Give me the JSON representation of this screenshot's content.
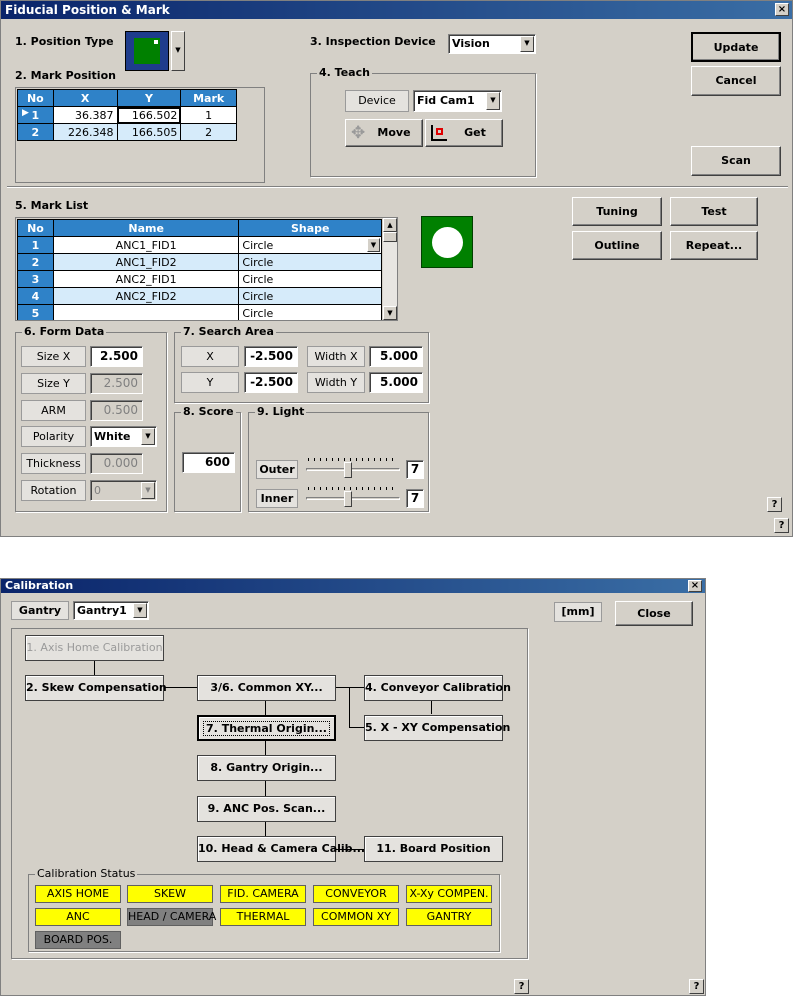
{
  "fiducial": {
    "title": "Fiducial Position & Mark",
    "close_glyph": "×",
    "position_type_label": "1. Position Type",
    "mark_position_label": "2. Mark Position",
    "mark_position_table": {
      "headers": [
        "No",
        "X",
        "Y",
        "Mark"
      ],
      "rows": [
        {
          "no": "1",
          "x": "36.387",
          "y": "166.502",
          "mark": "1"
        },
        {
          "no": "2",
          "x": "226.348",
          "y": "166.505",
          "mark": "2"
        }
      ]
    },
    "inspection_device_label": "3. Inspection Device",
    "inspection_device_value": "Vision",
    "teach": {
      "group_label": "4. Teach",
      "device_label": "Device",
      "device_value": "Fid Cam1",
      "move_label": "Move",
      "get_label": "Get"
    },
    "update_label": "Update",
    "cancel_label": "Cancel",
    "scan_label": "Scan",
    "mark_list_label": "5. Mark List",
    "mark_list_table": {
      "headers": [
        "No",
        "Name",
        "Shape"
      ],
      "rows": [
        {
          "no": "1",
          "name": "ANC1_FID1",
          "shape": "Circle"
        },
        {
          "no": "2",
          "name": "ANC1_FID2",
          "shape": "Circle"
        },
        {
          "no": "3",
          "name": "ANC2_FID1",
          "shape": "Circle"
        },
        {
          "no": "4",
          "name": "ANC2_FID2",
          "shape": "Circle"
        },
        {
          "no": "5",
          "name": "",
          "shape": "Circle"
        }
      ]
    },
    "tuning_label": "Tuning",
    "test_label": "Test",
    "outline_label": "Outline",
    "repeat_label": "Repeat...",
    "form_data": {
      "group_label": "6. Form Data",
      "size_x_label": "Size X",
      "size_x_value": "2.500",
      "size_y_label": "Size Y",
      "size_y_value": "2.500",
      "arm_label": "ARM",
      "arm_value": "0.500",
      "polarity_label": "Polarity",
      "polarity_value": "White",
      "thickness_label": "Thickness",
      "thickness_value": "0.000",
      "rotation_label": "Rotation",
      "rotation_value": "0"
    },
    "search_area": {
      "group_label": "7. Search Area",
      "x_label": "X",
      "x_value": "-2.500",
      "y_label": "Y",
      "y_value": "-2.500",
      "width_x_label": "Width X",
      "width_x_value": "5.000",
      "width_y_label": "Width Y",
      "width_y_value": "5.000"
    },
    "score": {
      "group_label": "8. Score",
      "value": "600"
    },
    "light": {
      "group_label": "9. Light",
      "outer_label": "Outer",
      "outer_value": "7",
      "outer_level_fraction": 0.44,
      "inner_label": "Inner",
      "inner_value": "7",
      "inner_level_fraction": 0.44
    },
    "help_glyph": "?"
  },
  "calibration": {
    "title": "Calibration",
    "close_glyph": "×",
    "gantry_label": "Gantry",
    "gantry_value": "Gantry1",
    "unit_label": "[mm]",
    "close_label": "Close",
    "steps": {
      "axis_home": "1. Axis Home Calibration",
      "skew": "2. Skew Compensation",
      "common_xy": "3/6. Common XY...",
      "conveyor": "4. Conveyor Calibration",
      "xy_comp": "5. X - XY Compensation",
      "thermal": "7. Thermal Origin...",
      "gantry_origin": "8. Gantry Origin...",
      "anc_scan": "9. ANC Pos. Scan...",
      "head_camera": "10. Head & Camera Calib...",
      "board_position": "11. Board Position"
    },
    "status_label": "Calibration Status",
    "status_items": [
      {
        "label": "AXIS HOME",
        "color": "#ffff00"
      },
      {
        "label": "SKEW",
        "color": "#ffff00"
      },
      {
        "label": "FID. CAMERA",
        "color": "#ffff00"
      },
      {
        "label": "CONVEYOR",
        "color": "#ffff00"
      },
      {
        "label": "X-Xy COMPEN.",
        "color": "#ffff00"
      },
      {
        "label": "ANC",
        "color": "#ffff00"
      },
      {
        "label": "HEAD / CAMERA",
        "color": "#808080"
      },
      {
        "label": "THERMAL",
        "color": "#ffff00"
      },
      {
        "label": "COMMON XY",
        "color": "#ffff00"
      },
      {
        "label": "GANTRY",
        "color": "#ffff00"
      },
      {
        "label": "BOARD POS.",
        "color": "#808080"
      }
    ],
    "help_glyph": "?"
  },
  "colors": {
    "title_bar": "#0a246a",
    "fiducial_green": "#008000",
    "grid_header": "#2f82c8"
  }
}
